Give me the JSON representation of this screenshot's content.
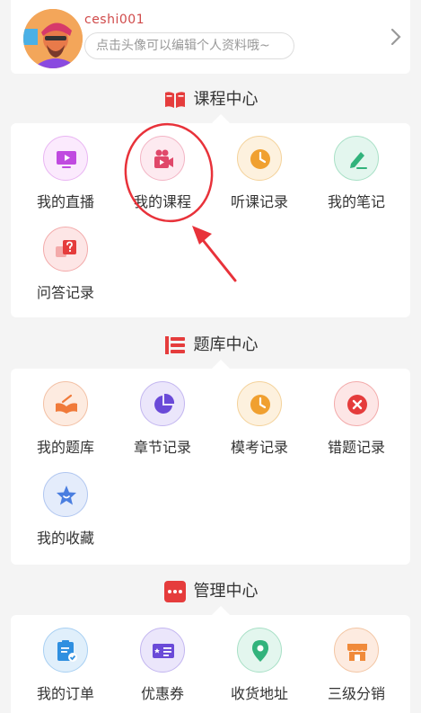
{
  "profile": {
    "username": "ceshi001",
    "hint": "点击头像可以编辑个人资料哦~"
  },
  "sections": {
    "course": {
      "title": "课程中心",
      "items": [
        {
          "label": "我的直播",
          "icon": "live-tv-icon",
          "color": "#c04ae0"
        },
        {
          "label": "我的课程",
          "icon": "video-camera-icon",
          "color": "#e0486a"
        },
        {
          "label": "听课记录",
          "icon": "clock-icon",
          "color": "#f0a030"
        },
        {
          "label": "我的笔记",
          "icon": "pen-icon",
          "color": "#32b37c"
        },
        {
          "label": "问答记录",
          "icon": "question-icon",
          "color": "#e53c3c"
        }
      ]
    },
    "question_bank": {
      "title": "题库中心",
      "items": [
        {
          "label": "我的题库",
          "icon": "book-icon",
          "color": "#f07a3a"
        },
        {
          "label": "章节记录",
          "icon": "pie-chart-icon",
          "color": "#6a4ad8"
        },
        {
          "label": "模考记录",
          "icon": "clock-icon",
          "color": "#f0a030"
        },
        {
          "label": "错题记录",
          "icon": "close-icon",
          "color": "#e53c3c"
        },
        {
          "label": "我的收藏",
          "icon": "star-icon",
          "color": "#4a7ee0"
        }
      ]
    },
    "management": {
      "title": "管理中心",
      "items": [
        {
          "label": "我的订单",
          "icon": "order-icon",
          "color": "#2f8fe0"
        },
        {
          "label": "优惠券",
          "icon": "coupon-icon",
          "color": "#6a4ad8"
        },
        {
          "label": "收货地址",
          "icon": "location-icon",
          "color": "#32b37c"
        },
        {
          "label": "三级分销",
          "icon": "shop-icon",
          "color": "#f08a3a"
        }
      ]
    }
  },
  "colors": {
    "accent_red": "#e53c3c",
    "annotation_red": "#e8323a"
  }
}
